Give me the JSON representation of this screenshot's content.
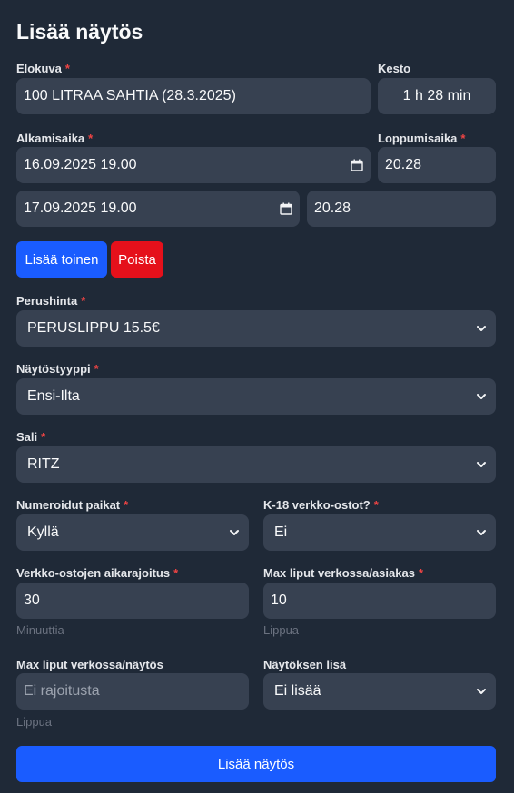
{
  "colors": {
    "background": "#1f2937",
    "field": "#374151",
    "primary": "#1a5cff",
    "danger": "#e5101b",
    "required": "#ef4444"
  },
  "page": {
    "title": "Lisää näytös"
  },
  "required_mark": "*",
  "movie": {
    "label": "Elokuva",
    "value": "100 LITRAA SAHTIA (28.3.2025)"
  },
  "duration": {
    "label": "Kesto",
    "value": "1 h 28 min"
  },
  "start": {
    "label": "Alkamisaika"
  },
  "end": {
    "label": "Loppumisaika"
  },
  "showings": [
    {
      "start": "16.09.2025 19.00",
      "end": "20.28"
    },
    {
      "start": "17.09.2025 19.00",
      "end": "20.28"
    }
  ],
  "buttons": {
    "add_another": "Lisää toinen",
    "remove": "Poista",
    "submit": "Lisää näytös"
  },
  "base_price": {
    "label": "Perushinta",
    "value": "PERUSLIPPU 15.5€"
  },
  "showing_type": {
    "label": "Näytöstyyppi",
    "value": "Ensi-Ilta"
  },
  "hall": {
    "label": "Sali",
    "value": "RITZ"
  },
  "numbered_seats": {
    "label": "Numeroidut paikat",
    "value": "Kyllä"
  },
  "k18_online": {
    "label": "K-18 verkko-ostot?",
    "value": "Ei"
  },
  "online_time_limit": {
    "label": "Verkko-ostojen aikarajoitus",
    "value": "30",
    "unit": "Minuuttia"
  },
  "max_per_customer": {
    "label": "Max liput verkossa/asiakas",
    "value": "10",
    "unit": "Lippua"
  },
  "max_per_showing": {
    "label": "Max liput verkossa/näytös",
    "placeholder": "Ei rajoitusta",
    "unit": "Lippua"
  },
  "showing_extra": {
    "label": "Näytöksen lisä",
    "value": "Ei lisää"
  }
}
